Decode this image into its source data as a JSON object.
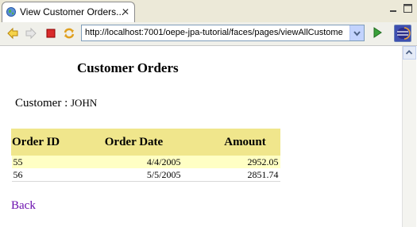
{
  "tab": {
    "title": "View Customer Orders...",
    "close_glyph": "✕"
  },
  "toolbar": {
    "url": "http://localhost:7001/oepe-jpa-tutorial/faces/pages/viewAllCustome",
    "icons": [
      "back-arrow-icon",
      "forward-arrow-icon",
      "stop-icon",
      "refresh-icon",
      "dropdown-icon",
      "go-icon",
      "eclipse-icon"
    ]
  },
  "page": {
    "title": "Customer Orders",
    "customer_label": "Customer : ",
    "customer_name": "JOHN",
    "table": {
      "headers": [
        "Order ID",
        "Order Date",
        "Amount"
      ],
      "rows": [
        {
          "id": "55",
          "date": "4/4/2005",
          "amount": "2952.05"
        },
        {
          "id": "56",
          "date": "5/5/2005",
          "amount": "2851.74"
        }
      ]
    },
    "back_label": "Back"
  },
  "colors": {
    "header_bg": "#f0e68c",
    "row_highlight": "#ffffc4",
    "link": "#6a0dad"
  }
}
